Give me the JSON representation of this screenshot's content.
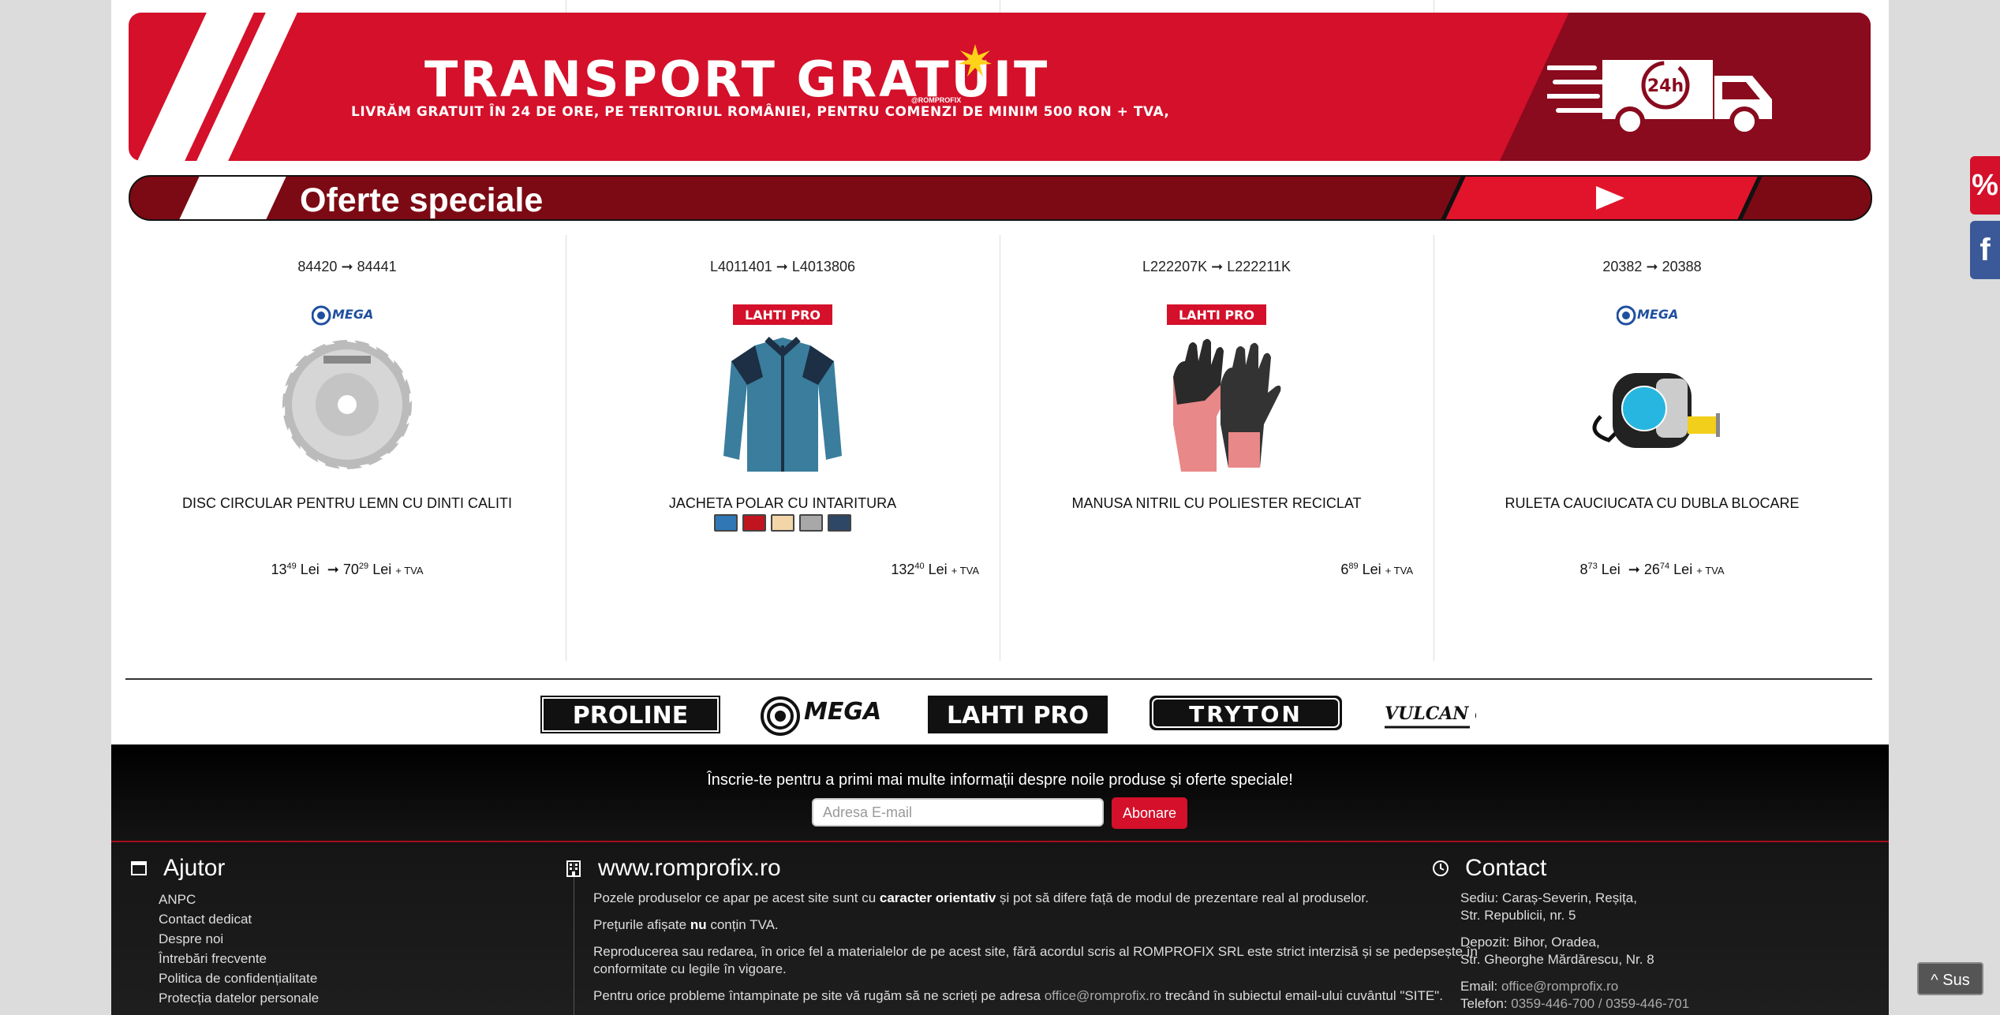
{
  "banner": {
    "title": "TRANSPORT GRATUIT",
    "brand_small": "@ROMPROFIX",
    "subtitle": "LIVRĂM GRATUIT ÎN 24 DE ORE, PE TERITORIUL ROMÂNIEI, PENTRU COMENZI DE MINIM 500 RON + TVA,",
    "badge": "24h"
  },
  "section": {
    "title": "Oferte speciale"
  },
  "products": [
    {
      "code_from": "84420",
      "code_to": "84441",
      "arrow": "➞",
      "brand": "MEGA",
      "name": "DISC CIRCULAR PENTRU LEMN CU DINTI CALITI",
      "price_from_int": "13",
      "price_from_dec": "49",
      "price_to_int": "70",
      "price_to_dec": "29",
      "currency": "Lei",
      "tax": "+ TVA"
    },
    {
      "code_from": "L4011401",
      "code_to": "L4013806",
      "arrow": "➞",
      "brand": "LAHTI PRO",
      "name": "JACHETA POLAR CU INTARITURA",
      "swatches": [
        "#2f78b5",
        "#c0141e",
        "#f3d6a8",
        "#a8a8a8",
        "#2e4766"
      ],
      "price_int": "132",
      "price_dec": "40",
      "currency": "Lei",
      "tax": "+ TVA"
    },
    {
      "code_from": "L222207K",
      "code_to": "L222211K",
      "arrow": "➞",
      "brand": "LAHTI PRO",
      "name": "MANUSA NITRIL CU POLIESTER RECICLAT",
      "price_int": "6",
      "price_dec": "89",
      "currency": "Lei",
      "tax": "+ TVA"
    },
    {
      "code_from": "20382",
      "code_to": "20388",
      "arrow": "➞",
      "brand": "MEGA",
      "name": "RULETA CAUCIUCATA CU DUBLA BLOCARE",
      "price_from_int": "8",
      "price_from_dec": "73",
      "price_to_int": "26",
      "price_to_dec": "74",
      "currency": "Lei",
      "tax": "+ TVA"
    }
  ],
  "brands": [
    "PROLINE",
    "MEGA",
    "LAHTI PRO",
    "TRYTON",
    "VULCAN concept"
  ],
  "newsletter": {
    "text": "Înscrie-te pentru a primi mai multe informații despre noile produse și oferte speciale!",
    "placeholder": "Adresa E-mail",
    "button": "Abonare"
  },
  "footer": {
    "help": {
      "title": "Ajutor",
      "items": [
        "ANPC",
        "Contact dedicat",
        "Despre noi",
        "Întrebări frecvente",
        "Politica de confidențialitate",
        "Protecția datelor personale"
      ]
    },
    "site": {
      "title": "www.romprofix.ro",
      "p1_a": "Pozele produselor ce apar pe acest site sunt cu ",
      "p1_b": "caracter orientativ",
      "p1_c": " și pot să difere față de modul de prezentare real al produselor.",
      "p2_a": "Prețurile afișate ",
      "p2_b": "nu",
      "p2_c": " conțin TVA.",
      "p3": "Reproducerea sau redarea, în orice fel a materialelor de pe acest site, fără acordul scris al ROMPROFIX SRL este strict interzisă și se pedepsește în conformitate cu legile în vigoare.",
      "p4_a": "Pentru orice probleme întampinate pe site vă rugăm să ne scrieți pe adresa ",
      "p4_link": "office@romprofix.ro",
      "p4_c": " trecând în subiectul email-ului cuvântul \"SITE\"."
    },
    "contact": {
      "title": "Contact",
      "hq_line1": "Sediu: Caraș-Severin, Reșița,",
      "hq_line2": "Str. Republicii, nr. 5",
      "dep_line1": "Depozit: Bihor, Oradea,",
      "dep_line2": "Str. Gheorghe Mărdărescu, Nr. 8",
      "email_label": "Email: ",
      "email": "office@romprofix.ro",
      "phone_label": "Telefon: ",
      "phone": "0359-446-700 / 0359-446-701"
    }
  },
  "side": {
    "discount": "%",
    "facebook": "f",
    "scroll_top": "Sus"
  },
  "colors": {
    "brand_red": "#d4102a",
    "dark_red": "#7c0a14",
    "facebook": "#3b5998"
  }
}
